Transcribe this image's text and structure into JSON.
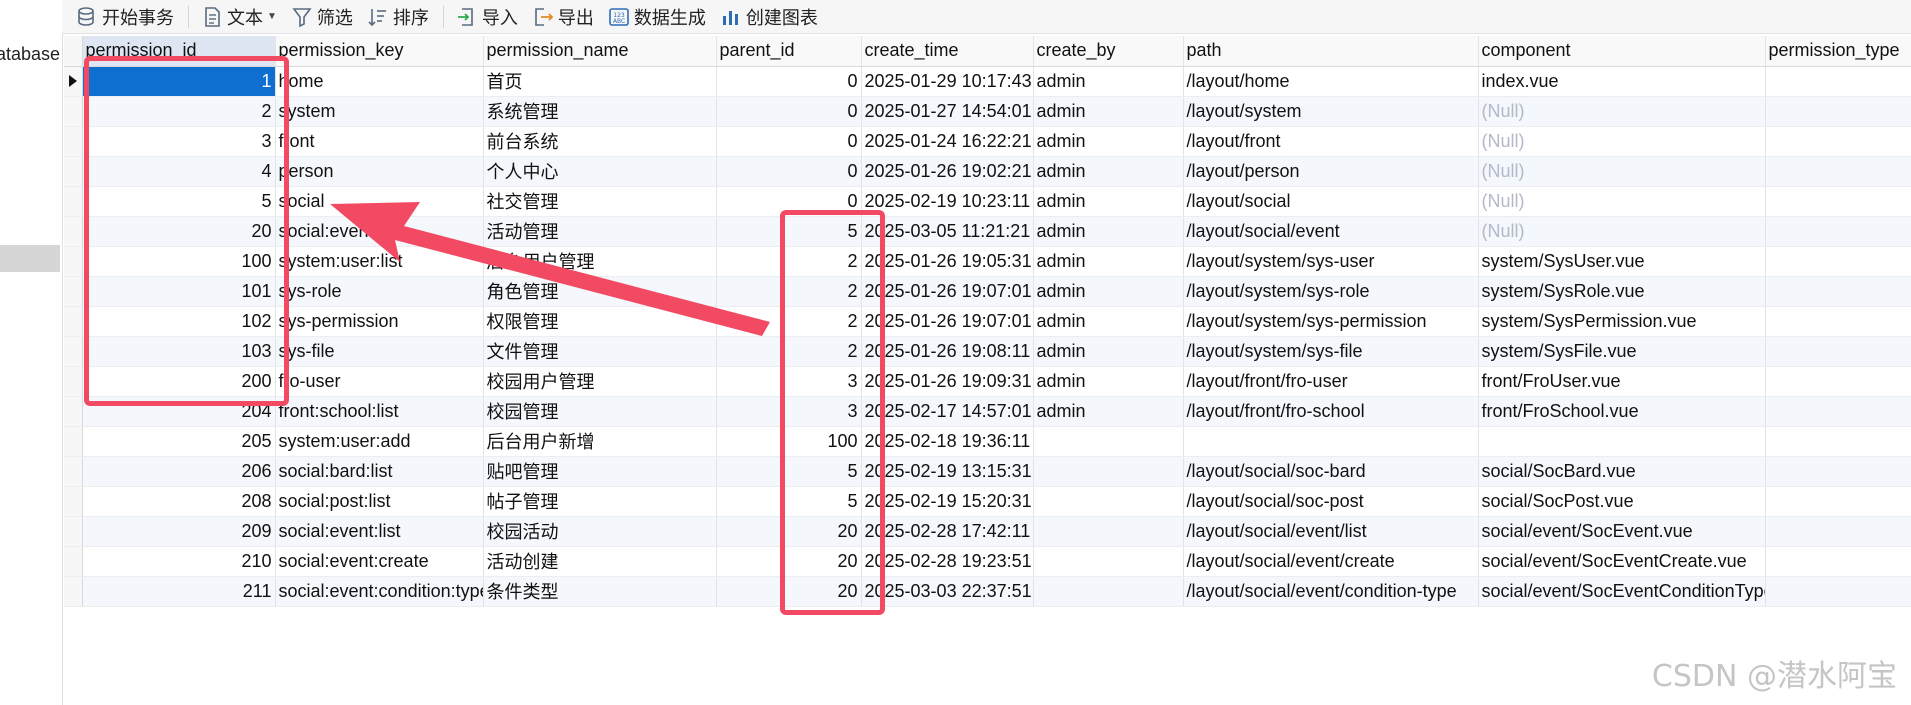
{
  "toolbar": {
    "begin_transaction": "开始事务",
    "text": "文本",
    "filter": "筛选",
    "sort": "排序",
    "import": "导入",
    "export": "导出",
    "data_generate": "数据生成",
    "create_chart": "创建图表"
  },
  "navigator": {
    "database_label": "atabase"
  },
  "grid": {
    "columns": [
      "permission_id",
      "permission_key",
      "permission_name",
      "parent_id",
      "create_time",
      "create_by",
      "path",
      "component",
      "permission_type"
    ],
    "rows": [
      [
        "1",
        "home",
        "首页",
        "0",
        "2025-01-29 10:17:43",
        "admin",
        "/layout/home",
        "index.vue",
        ""
      ],
      [
        "2",
        "system",
        "系统管理",
        "0",
        "2025-01-27 14:54:01",
        "admin",
        "/layout/system",
        "(Null)",
        ""
      ],
      [
        "3",
        "front",
        "前台系统",
        "0",
        "2025-01-24 16:22:21",
        "admin",
        "/layout/front",
        "(Null)",
        ""
      ],
      [
        "4",
        "person",
        "个人中心",
        "0",
        "2025-01-26 19:02:21",
        "admin",
        "/layout/person",
        "(Null)",
        ""
      ],
      [
        "5",
        "social",
        "社交管理",
        "0",
        "2025-02-19 10:23:11",
        "admin",
        "/layout/social",
        "(Null)",
        ""
      ],
      [
        "20",
        "social:event",
        "活动管理",
        "5",
        "2025-03-05 11:21:21",
        "admin",
        "/layout/social/event",
        "(Null)",
        ""
      ],
      [
        "100",
        "system:user:list",
        "后台用户管理",
        "2",
        "2025-01-26 19:05:31",
        "admin",
        "/layout/system/sys-user",
        "system/SysUser.vue",
        ""
      ],
      [
        "101",
        "sys-role",
        "角色管理",
        "2",
        "2025-01-26 19:07:01",
        "admin",
        "/layout/system/sys-role",
        "system/SysRole.vue",
        ""
      ],
      [
        "102",
        "sys-permission",
        "权限管理",
        "2",
        "2025-01-26 19:07:01",
        "admin",
        "/layout/system/sys-permission",
        "system/SysPermission.vue",
        ""
      ],
      [
        "103",
        "sys-file",
        "文件管理",
        "2",
        "2025-01-26 19:08:11",
        "admin",
        "/layout/system/sys-file",
        "system/SysFile.vue",
        ""
      ],
      [
        "200",
        "fro-user",
        "校园用户管理",
        "3",
        "2025-01-26 19:09:31",
        "admin",
        "/layout/front/fro-user",
        "front/FroUser.vue",
        ""
      ],
      [
        "204",
        "front:school:list",
        "校园管理",
        "3",
        "2025-02-17 14:57:01",
        "admin",
        "/layout/front/fro-school",
        "front/FroSchool.vue",
        ""
      ],
      [
        "205",
        "system:user:add",
        "后台用户新增",
        "100",
        "2025-02-18 19:36:11",
        "",
        "",
        "",
        ""
      ],
      [
        "206",
        "social:bard:list",
        "贴吧管理",
        "5",
        "2025-02-19 13:15:31",
        "",
        "/layout/social/soc-bard",
        "social/SocBard.vue",
        ""
      ],
      [
        "208",
        "social:post:list",
        "帖子管理",
        "5",
        "2025-02-19 15:20:31",
        "",
        "/layout/social/soc-post",
        "social/SocPost.vue",
        ""
      ],
      [
        "209",
        "social:event:list",
        "校园活动",
        "20",
        "2025-02-28 17:42:11",
        "",
        "/layout/social/event/list",
        "social/event/SocEvent.vue",
        ""
      ],
      [
        "210",
        "social:event:create",
        "活动创建",
        "20",
        "2025-02-28 19:23:51",
        "",
        "/layout/social/event/create",
        "social/event/SocEventCreate.vue",
        ""
      ],
      [
        "211",
        "social:event:condition:type",
        "条件类型",
        "20",
        "2025-03-03 22:37:51",
        "",
        "/layout/social/event/condition-type",
        "social/event/SocEventConditionType.vue",
        ""
      ]
    ]
  },
  "watermark": "CSDN @潜水阿宝",
  "colors": {
    "selection": "#0f6fd0",
    "annotation": "#f14a62",
    "null_text": "#b4b8c8"
  }
}
